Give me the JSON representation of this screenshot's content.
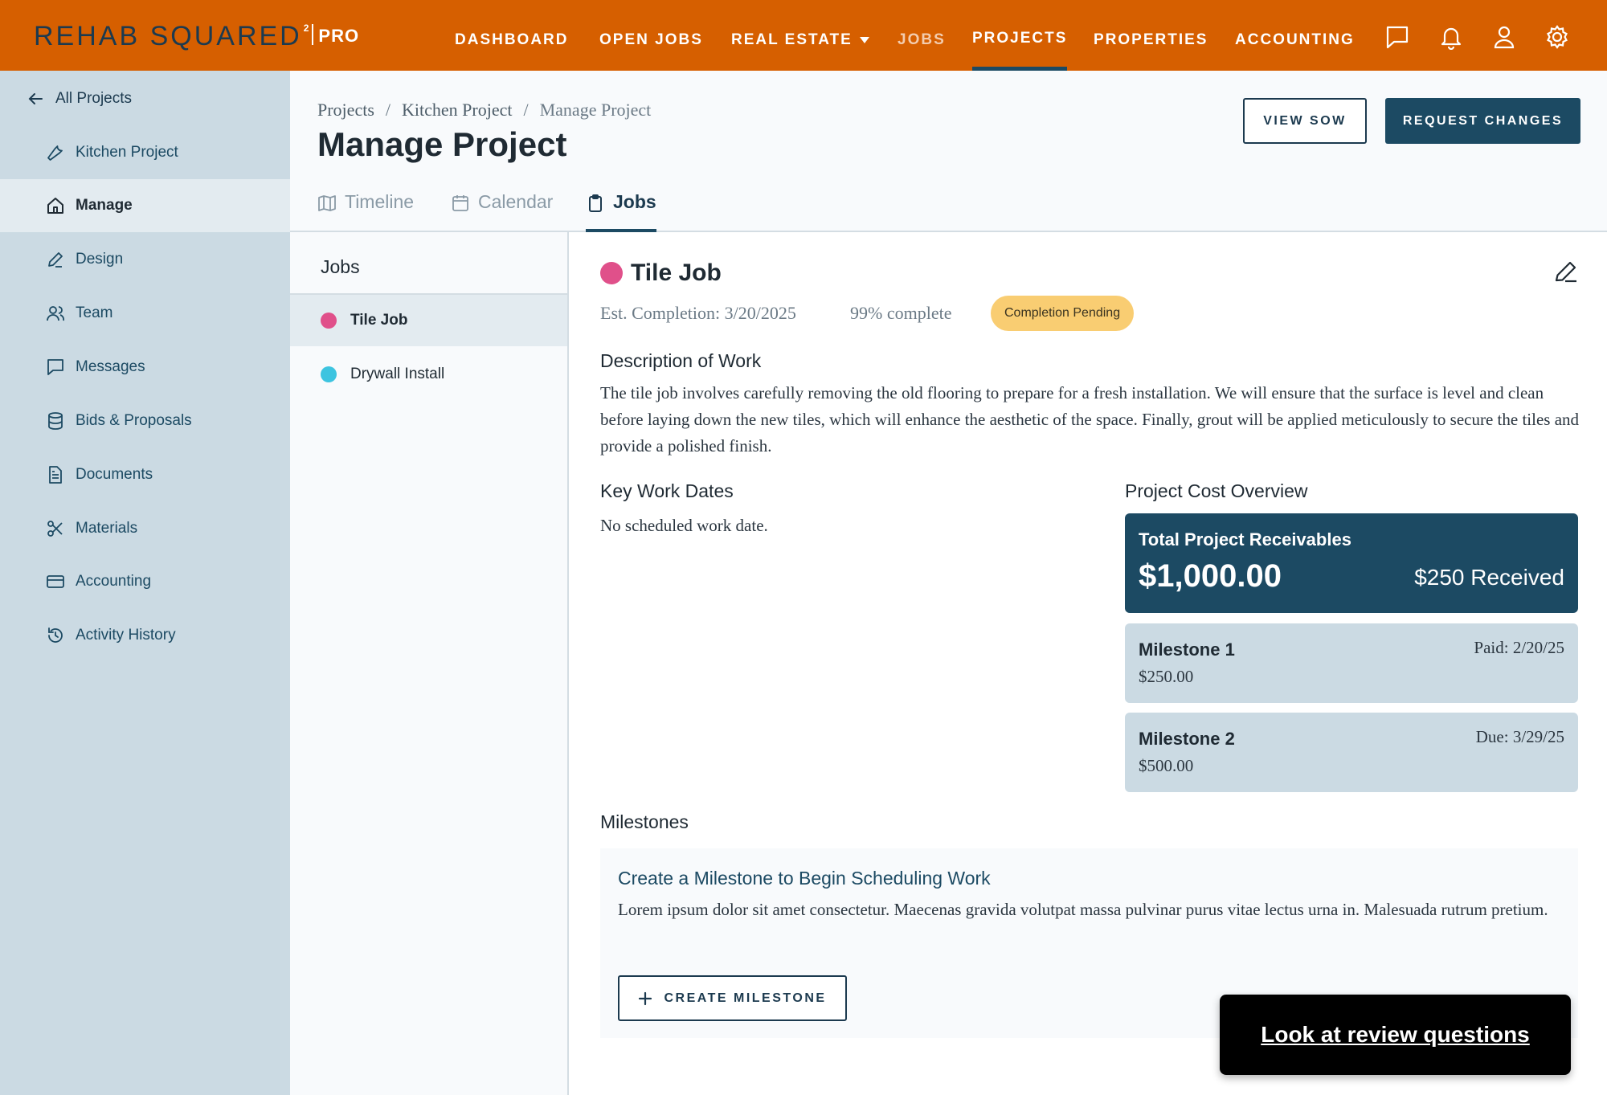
{
  "brand": {
    "name": "REHAB SQUARED",
    "superscript": "2",
    "tier": "PRO"
  },
  "topnav": {
    "items": [
      "DASHBOARD",
      "OPEN JOBS",
      "REAL ESTATE",
      "JOBS",
      "PROJECTS",
      "PROPERTIES",
      "ACCOUNTING"
    ],
    "active": "PROJECTS",
    "icons": [
      "chat-icon",
      "bell-icon",
      "user-icon",
      "gear-icon"
    ]
  },
  "sidebar": {
    "back_label": "All Projects",
    "items": [
      {
        "label": "Kitchen Project",
        "icon": "wrench-icon"
      },
      {
        "label": "Manage",
        "icon": "home-icon"
      },
      {
        "label": "Design",
        "icon": "pencil-icon"
      },
      {
        "label": "Team",
        "icon": "users-icon"
      },
      {
        "label": "Messages",
        "icon": "message-icon"
      },
      {
        "label": "Bids & Proposals",
        "icon": "database-icon"
      },
      {
        "label": "Documents",
        "icon": "document-icon"
      },
      {
        "label": "Materials",
        "icon": "scissors-icon"
      },
      {
        "label": "Accounting",
        "icon": "credit-card-icon"
      },
      {
        "label": "Activity History",
        "icon": "history-icon"
      }
    ],
    "active": "Manage"
  },
  "breadcrumb": [
    "Projects",
    "Kitchen Project",
    "Manage Project"
  ],
  "breadcrumb_sep": "/",
  "page_title": "Manage Project",
  "actions": {
    "view_sow": "VIEW SOW",
    "request_changes": "REQUEST CHANGES"
  },
  "tabs": [
    {
      "label": "Timeline",
      "icon": "map-icon"
    },
    {
      "label": "Calendar",
      "icon": "calendar-icon"
    },
    {
      "label": "Jobs",
      "icon": "clipboard-icon"
    }
  ],
  "active_tab": "Jobs",
  "jobs_panel": {
    "title": "Jobs",
    "items": [
      {
        "label": "Tile Job",
        "color": "#e0508a"
      },
      {
        "label": "Drywall Install",
        "color": "#3dc4e0"
      }
    ],
    "active": "Tile Job"
  },
  "job": {
    "name": "Tile Job",
    "color": "#e0508a",
    "est_completion": "Est. Completion: 3/20/2025",
    "percent_complete": "99% complete",
    "status": "Completion Pending",
    "description_title": "Description of Work",
    "description": "The tile job involves carefully removing the old flooring to prepare for a fresh installation. We will ensure that the surface is level and clean before laying down the new tiles, which will enhance the aesthetic of the space. Finally, grout will be applied meticulously to secure the tiles and provide a polished finish.",
    "key_dates_title": "Key Work Dates",
    "key_dates_text": "No scheduled work date."
  },
  "cost_overview": {
    "title": "Project Cost Overview",
    "receivables_label": "Total Project Receivables",
    "receivables_amount": "$1,000.00",
    "received": "$250 Received",
    "milestones": [
      {
        "name": "Milestone 1",
        "amount": "$250.00",
        "status": "Paid: 2/20/25"
      },
      {
        "name": "Milestone 2",
        "amount": "$500.00",
        "status": "Due: 3/29/25"
      }
    ]
  },
  "milestones_section": {
    "title": "Milestones",
    "empty_title": "Create a Milestone to Begin Scheduling Work",
    "empty_text": "Lorem ipsum dolor sit amet consectetur. Maecenas gravida volutpat massa pulvinar purus vitae lectus urna in. Malesuada rutrum pretium.",
    "button": "CREATE MILESTONE"
  },
  "review_button": "Look at review questions",
  "colors": {
    "topbar": "#d65f00",
    "primary": "#1c4a63",
    "sidebar": "#cbdae3",
    "badge": "#f9cd72"
  }
}
